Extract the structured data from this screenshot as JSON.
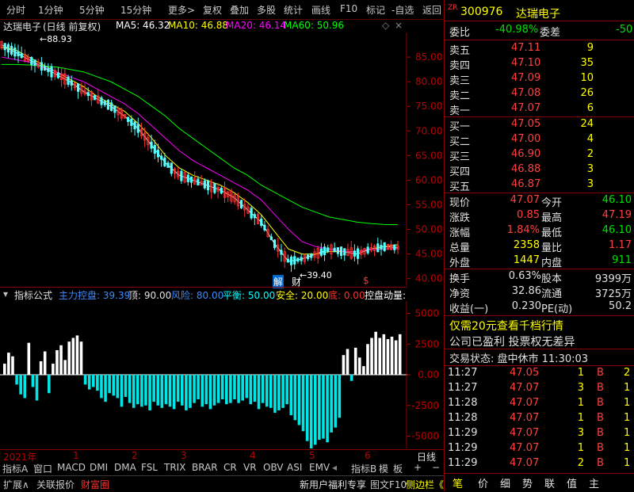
{
  "topbar": {
    "items": [
      "分时",
      "1分钟",
      "5分钟",
      "15分钟",
      "更多>",
      "复权",
      "叠加",
      "多股",
      "统计",
      "画线",
      "F10",
      "标记",
      "-自选",
      "返回"
    ]
  },
  "chart": {
    "stock_name": "达瑞电子",
    "period": "(日线 前复权)",
    "ma5": "MA5: 46.32",
    "ma10": "MA10: 46.88",
    "ma20": "MA20: 46.14",
    "ma60": "MA60: 50.96",
    "high_label": "88.93",
    "low_label": "39.40",
    "marker_jie": "解",
    "marker_cai": "财",
    "marker_dollar": "$",
    "colors": {
      "ma5": "#ffffff",
      "ma10": "#ffff00",
      "ma20": "#ff00ff",
      "ma60": "#00ff00",
      "up": "#ff3030",
      "down": "#54ffff"
    }
  },
  "chart_data": [
    {
      "type": "candlestick",
      "title": "达瑞电子 (日线 前复权)",
      "y_ticks": [
        "85.00",
        "80.00",
        "75.00",
        "70.00",
        "65.00",
        "60.00",
        "55.00",
        "50.00",
        "45.00",
        "40.00"
      ],
      "ylim": [
        38.5,
        90
      ],
      "x_ticks": [
        "2021年",
        "1",
        "2",
        "3",
        "4",
        "5",
        "6"
      ],
      "series": [
        {
          "name": "MA5",
          "values": [
            87.5,
            86.0,
            84.5,
            83.0,
            81.5,
            80.0,
            78.0,
            76.5,
            75.0,
            73.0,
            70.5,
            67.0,
            63.5,
            61.0,
            60.0,
            59.0,
            58.0,
            56.5,
            54.0,
            51.5,
            47.0,
            43.5,
            44.0,
            45.0,
            46.0,
            45.5,
            45.0,
            46.0,
            46.5,
            46.3
          ]
        },
        {
          "name": "MA10",
          "values": [
            87.0,
            86.5,
            85.0,
            83.5,
            82.0,
            80.5,
            79.0,
            77.0,
            75.5,
            74.0,
            71.5,
            68.5,
            65.0,
            62.5,
            61.0,
            60.0,
            59.0,
            57.5,
            55.5,
            53.0,
            49.5,
            46.0,
            45.0,
            45.0,
            45.5,
            45.5,
            45.5,
            46.0,
            46.5,
            46.9
          ]
        },
        {
          "name": "MA20",
          "values": [
            85.0,
            84.5,
            84.0,
            83.0,
            82.0,
            81.0,
            80.0,
            78.5,
            77.0,
            75.5,
            73.5,
            71.0,
            68.5,
            66.0,
            64.0,
            62.5,
            61.0,
            59.5,
            58.0,
            56.0,
            53.0,
            50.0,
            47.5,
            46.5,
            46.0,
            45.5,
            45.5,
            46.0,
            46.0,
            46.1
          ]
        },
        {
          "name": "MA60",
          "values": [
            83.5,
            83.5,
            83.4,
            83.2,
            83.0,
            82.5,
            82.0,
            81.0,
            80.0,
            78.5,
            77.0,
            75.0,
            73.0,
            70.5,
            68.5,
            66.5,
            64.5,
            62.5,
            61.0,
            59.0,
            57.5,
            56.0,
            54.5,
            53.5,
            52.5,
            52.0,
            51.5,
            51.2,
            51.0,
            50.96
          ]
        }
      ]
    },
    {
      "type": "bar",
      "title": "主力控盘",
      "y_ticks": [
        "5000",
        "2500",
        "0.00",
        "-2500",
        "-5000"
      ],
      "ylim": [
        -6000,
        6000
      ],
      "values": [
        900,
        1800,
        1500,
        -800,
        -1600,
        -1900,
        2600,
        -1000,
        -2100,
        1100,
        1900,
        -1500,
        900,
        2000,
        2400,
        1200,
        2700,
        3000,
        3200,
        2700,
        -800,
        -1200,
        -1000,
        -1300,
        -1900,
        -2200,
        -1500,
        -1700,
        -1900,
        -2600,
        -1800,
        -2300,
        -2700,
        -2400,
        -2600,
        -2500,
        -2900,
        -2200,
        -2500,
        -2700,
        -2400,
        -2600,
        -2800,
        -2200,
        -2500,
        -2900,
        -2700,
        -2300,
        -2000,
        -2600,
        -2400,
        -2800,
        -2500,
        -2300,
        -2000,
        -2400,
        -2300,
        -2000,
        -2300,
        -2100,
        -1900,
        -2400,
        -2200,
        -2800,
        -2300,
        -2600,
        -2700,
        -3100,
        -2900,
        -2700,
        -2400,
        -3300,
        -3700,
        -4100,
        -4600,
        -5400,
        -6100,
        -5700,
        -5300,
        -5200,
        -5500,
        -4700,
        -4300,
        -3500,
        1600,
        2100,
        -500,
        2200,
        1400,
        700,
        2500,
        3000,
        3500,
        3000,
        3300,
        2900,
        3100,
        2800,
        3300
      ]
    }
  ],
  "indicator": {
    "title": "指标公式",
    "name": "主力控盘: 39.39",
    "top": "顶: 90.00",
    "risk": "风险: 80.00",
    "balance": "平衡: 50.00",
    "safe": "安全: 20.00",
    "bottom": "底: 0.00",
    "control": "控盘动量:"
  },
  "tabs": {
    "items": [
      "指标A",
      "窗口",
      "MACD",
      "DMI",
      "DMA",
      "FSL",
      "TRIX",
      "BRAR",
      "CR",
      "VR",
      "OBV",
      "ASI",
      "EMV",
      "指标B",
      "模",
      "板",
      "+",
      "−",
      "日线"
    ]
  },
  "bottombar": {
    "left1": "扩展∧",
    "left2": "关联报价",
    "left3": "财富圈",
    "right1": "新用户福利专享",
    "right2": "图文F10",
    "right3": "侧边栏《"
  },
  "quote": {
    "tag": "ZR",
    "code": "300976",
    "name": "达瑞电子",
    "weibi_label": "委比",
    "weibi_value": "-40.98%",
    "weicha_label": "委差",
    "weicha_value": "-50",
    "sells": [
      {
        "label": "卖五",
        "price": "47.11",
        "vol": "9"
      },
      {
        "label": "卖四",
        "price": "47.10",
        "vol": "35"
      },
      {
        "label": "卖三",
        "price": "47.09",
        "vol": "10"
      },
      {
        "label": "卖二",
        "price": "47.08",
        "vol": "26"
      },
      {
        "label": "卖一",
        "price": "47.07",
        "vol": "6"
      }
    ],
    "buys": [
      {
        "label": "买一",
        "price": "47.05",
        "vol": "24"
      },
      {
        "label": "买二",
        "price": "47.00",
        "vol": "4"
      },
      {
        "label": "买三",
        "price": "46.90",
        "vol": "2"
      },
      {
        "label": "买四",
        "price": "46.88",
        "vol": "3"
      },
      {
        "label": "买五",
        "price": "46.87",
        "vol": "3"
      }
    ],
    "stats": [
      {
        "l1": "现价",
        "v1": "47.07",
        "l2": "今开",
        "v2": "46.10"
      },
      {
        "l1": "涨跌",
        "v1": "0.85",
        "l2": "最高",
        "v2": "47.19"
      },
      {
        "l1": "涨幅",
        "v1": "1.84%",
        "l2": "最低",
        "v2": "46.10"
      },
      {
        "l1": "总量",
        "v1": "2358",
        "l2": "量比",
        "v2": "1.17"
      },
      {
        "l1": "外盘",
        "v1": "1447",
        "l2": "内盘",
        "v2": "911"
      }
    ],
    "fund": [
      {
        "l1": "换手",
        "v1": "0.63%",
        "l2": "股本",
        "v2": "9399万"
      },
      {
        "l1": "净资",
        "v1": "32.86",
        "l2": "流通",
        "v2": "3725万"
      },
      {
        "l1": "收益(一)",
        "v1": "0.230",
        "l2": "PE(动)",
        "v2": "50.2"
      }
    ],
    "promo": "仅需20元查看千档行情",
    "notice": "公司已盈利 投票权无差异",
    "status": "交易状态: 盘中休市 11:30:03",
    "ticks": [
      {
        "t": "11:27",
        "p": "47.05",
        "v": "1",
        "d": "B",
        "n": "2"
      },
      {
        "t": "11:27",
        "p": "47.07",
        "v": "3",
        "d": "B",
        "n": "1"
      },
      {
        "t": "11:28",
        "p": "47.07",
        "v": "1",
        "d": "B",
        "n": "1"
      },
      {
        "t": "11:28",
        "p": "47.07",
        "v": "1",
        "d": "B",
        "n": "1"
      },
      {
        "t": "11:29",
        "p": "47.07",
        "v": "3",
        "d": "B",
        "n": "1"
      },
      {
        "t": "11:29",
        "p": "47.07",
        "v": "1",
        "d": "B",
        "n": "1"
      },
      {
        "t": "11:29",
        "p": "47.07",
        "v": "2",
        "d": "B",
        "n": "1"
      }
    ],
    "bottom_tabs": [
      "笔",
      "价",
      "细",
      "势",
      "联",
      "值",
      "主"
    ]
  }
}
